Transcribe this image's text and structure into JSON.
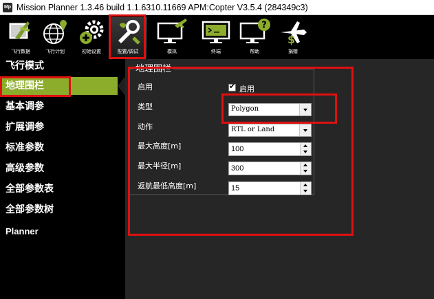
{
  "window": {
    "icon_text": "Mp",
    "title": "Mission Planner 1.3.46 build 1.1.6310.11669 APM:Copter V3.5.4 (284349c3)"
  },
  "toolbar": {
    "buttons": [
      {
        "label": "飞行数据",
        "icon": "plane-icon"
      },
      {
        "label": "飞行计划",
        "icon": "globe-icon"
      },
      {
        "label": "初始设置",
        "icon": "gear-plus-icon"
      },
      {
        "label": "配置/调试",
        "icon": "wrench-icon"
      },
      {
        "label": "模拟",
        "icon": "monitor-plane-icon"
      },
      {
        "label": "终端",
        "icon": "terminal-icon"
      },
      {
        "label": "帮助",
        "icon": "help-monitor-icon"
      },
      {
        "label": "捐赠",
        "icon": "donate-plane-icon"
      }
    ]
  },
  "nav": {
    "items": [
      {
        "label": "飞行模式"
      },
      {
        "label": "地理围栏"
      },
      {
        "label": "基本调参"
      },
      {
        "label": "扩展调参"
      },
      {
        "label": "标准参数"
      },
      {
        "label": "高级参数"
      },
      {
        "label": "全部参数表"
      },
      {
        "label": "全部参数树"
      },
      {
        "label": "Planner"
      }
    ],
    "selected": "地理围栏"
  },
  "geofence": {
    "title": "地理围栏",
    "enable": {
      "label": "启用",
      "checkbox_label": "启用",
      "checked": true
    },
    "type": {
      "label": "类型",
      "value": "Polygon"
    },
    "action": {
      "label": "动作",
      "value": "RTL or Land"
    },
    "max_alt": {
      "label": "最大高度[m]",
      "value": "100"
    },
    "max_radius": {
      "label": "最大半径[m]",
      "value": "300"
    },
    "rtl_min_alt": {
      "label": "返航最低高度[m]",
      "value": "15"
    }
  },
  "colors": {
    "nav_selected": "#8cac2c",
    "annotation_red": "#e01010",
    "panel_bg": "#262626"
  }
}
